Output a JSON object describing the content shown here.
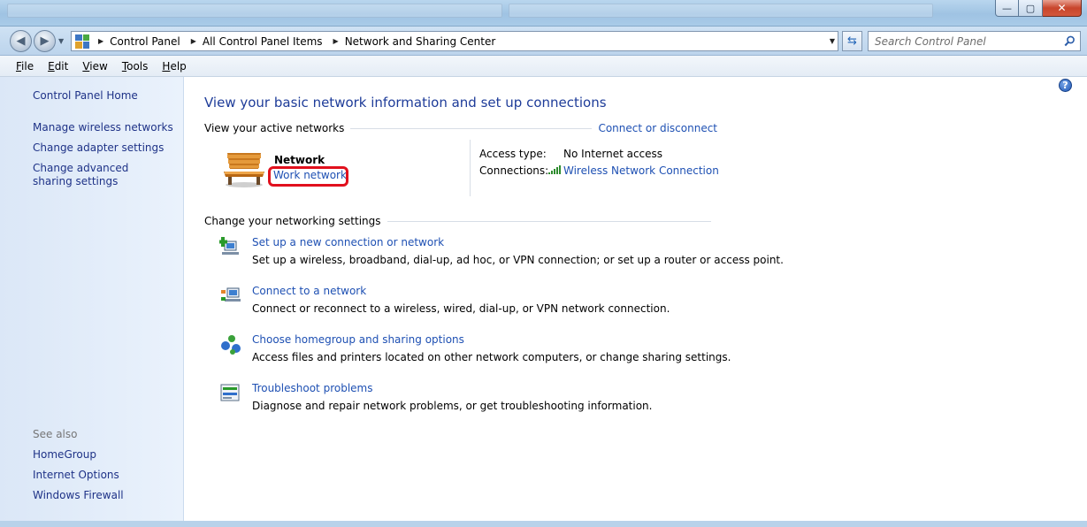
{
  "window": {
    "controls": {
      "minimize": "—",
      "maximize": "▢",
      "close": "✕"
    }
  },
  "address": {
    "breadcrumbs": [
      "Control Panel",
      "All Control Panel Items",
      "Network and Sharing Center"
    ],
    "search_placeholder": "Search Control Panel"
  },
  "menu": {
    "items": [
      {
        "label": "File",
        "ul": "F",
        "rest": "ile"
      },
      {
        "label": "Edit",
        "ul": "E",
        "rest": "dit"
      },
      {
        "label": "View",
        "ul": "V",
        "rest": "iew"
      },
      {
        "label": "Tools",
        "ul": "T",
        "rest": "ools"
      },
      {
        "label": "Help",
        "ul": "H",
        "rest": "elp"
      }
    ]
  },
  "sidebar": {
    "home": "Control Panel Home",
    "links": [
      "Manage wireless networks",
      "Change adapter settings",
      "Change advanced sharing settings"
    ],
    "see_also_heading": "See also",
    "see_also": [
      "HomeGroup",
      "Internet Options",
      "Windows Firewall"
    ]
  },
  "main": {
    "title": "View your basic network information and set up connections",
    "active_networks_label": "View your active networks",
    "connect_link": "Connect or disconnect",
    "network": {
      "name": "Network",
      "type": "Work network",
      "access_label": "Access type:",
      "access_value": "No Internet access",
      "connections_label": "Connections:",
      "connection_link": "Wireless Network Connection"
    },
    "change_settings_label": "Change your networking settings",
    "tasks": [
      {
        "icon": "new-connection-icon",
        "link": "Set up a new connection or network",
        "desc": "Set up a wireless, broadband, dial-up, ad hoc, or VPN connection; or set up a router or access point."
      },
      {
        "icon": "connect-network-icon",
        "link": "Connect to a network",
        "desc": "Connect or reconnect to a wireless, wired, dial-up, or VPN network connection."
      },
      {
        "icon": "homegroup-icon",
        "link": "Choose homegroup and sharing options",
        "desc": "Access files and printers located on other network computers, or change sharing settings."
      },
      {
        "icon": "troubleshoot-icon",
        "link": "Troubleshoot problems",
        "desc": "Diagnose and repair network problems, or get troubleshooting information."
      }
    ]
  },
  "colors": {
    "link": "#1e50b3",
    "title": "#1e3c99",
    "sidebar_bg": "#dbe7f7",
    "highlight_ring": "#e1101d"
  }
}
